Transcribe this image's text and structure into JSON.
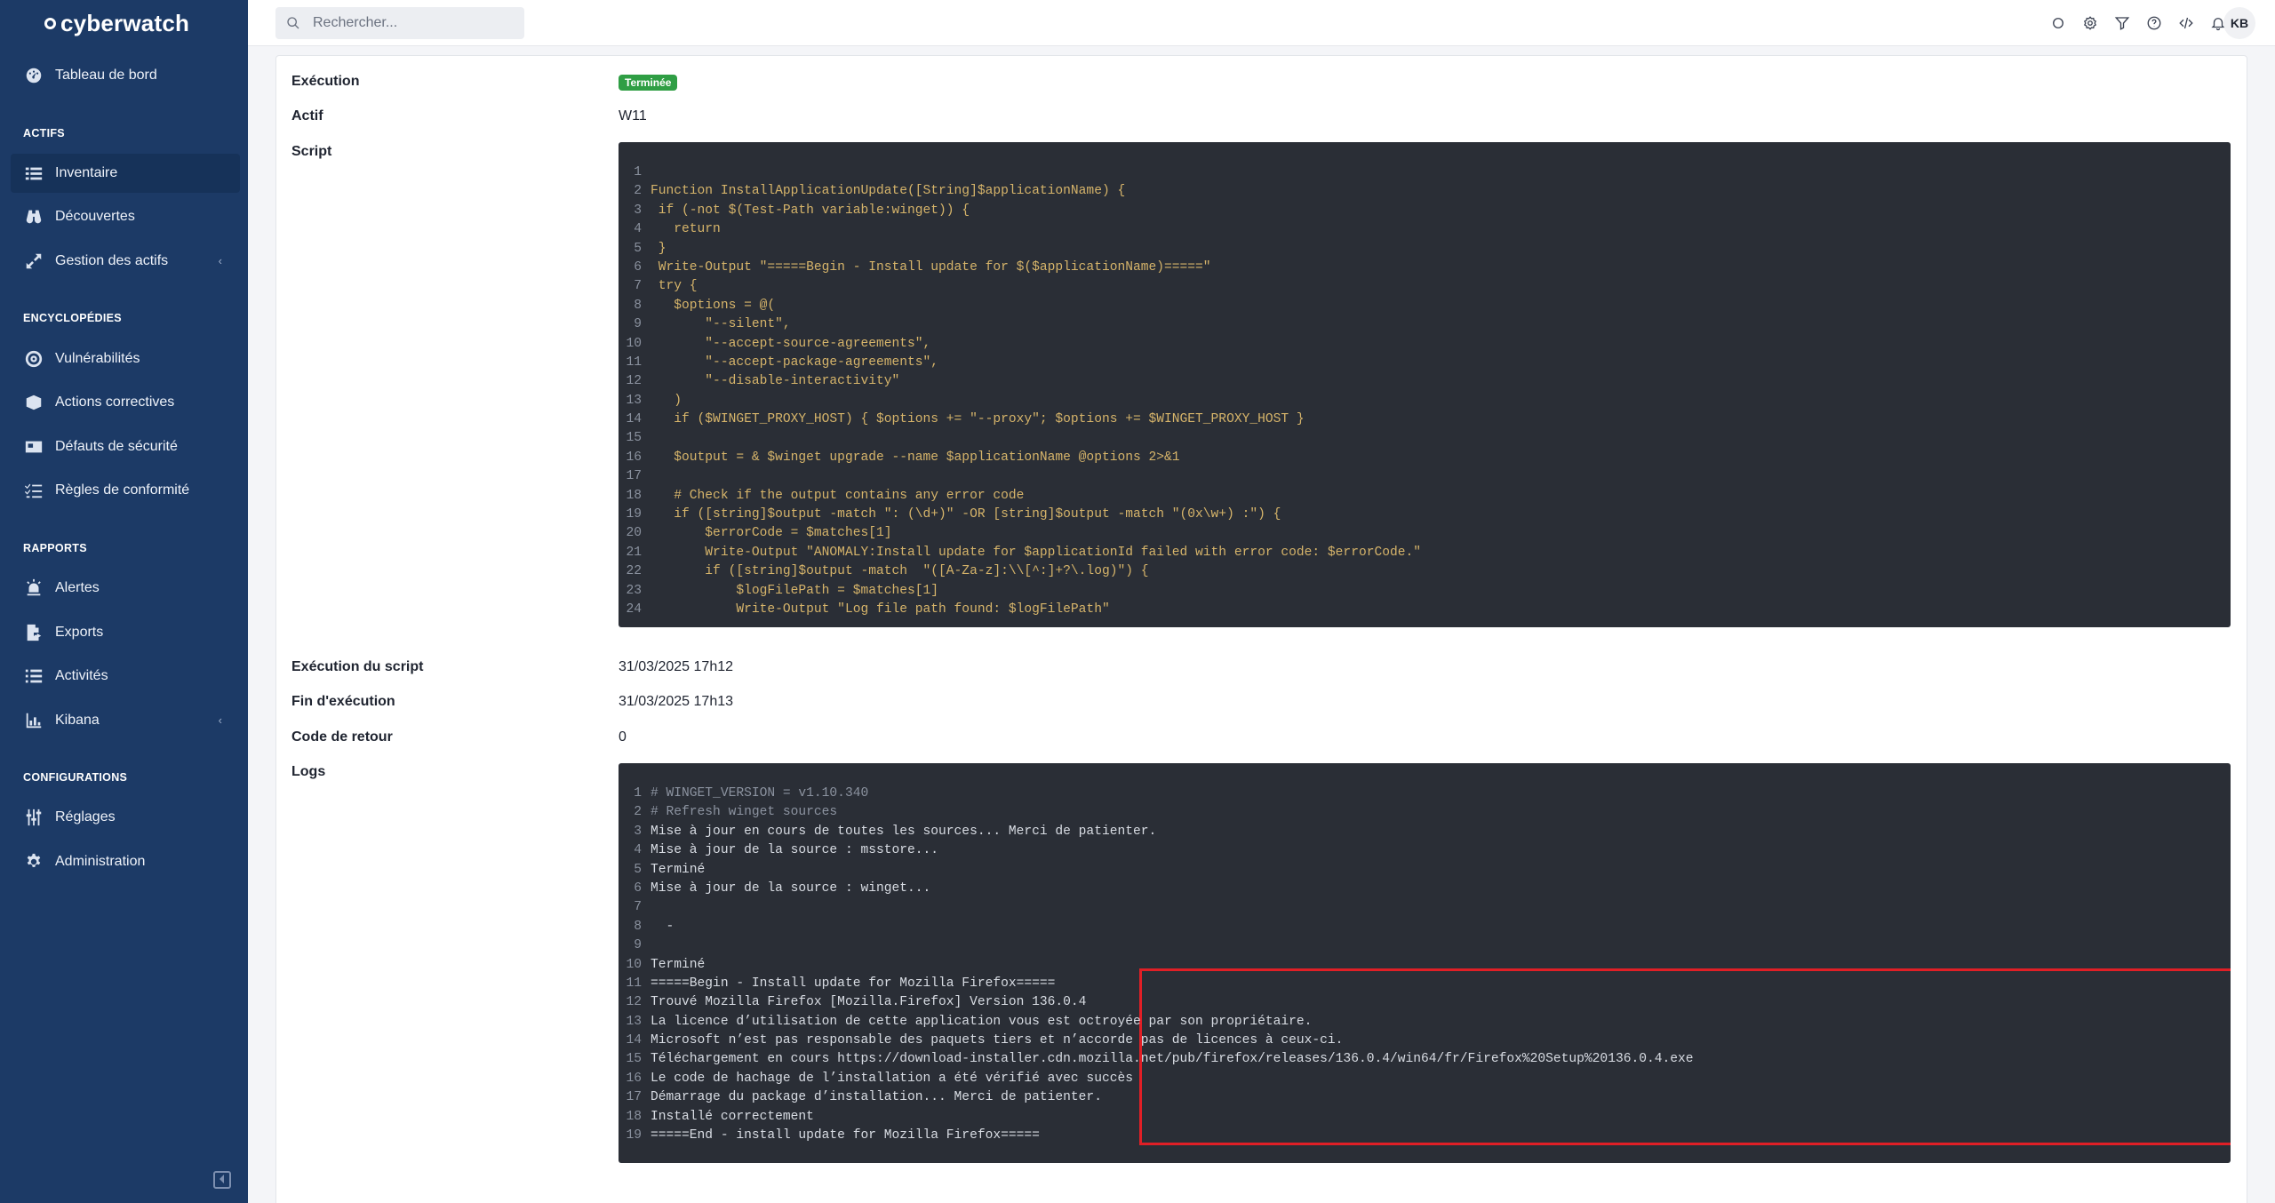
{
  "brand": {
    "name": "cyberwatch"
  },
  "sidebar": {
    "top_items": [
      {
        "label": "Tableau de bord",
        "icon": "dashboard-icon"
      }
    ],
    "sections": [
      {
        "title": "ACTIFS",
        "items": [
          {
            "label": "Inventaire",
            "icon": "list-icon",
            "active": true
          },
          {
            "label": "Découvertes",
            "icon": "binoculars-icon"
          },
          {
            "label": "Gestion des actifs",
            "icon": "expand-icon",
            "has_chevron": true
          }
        ]
      },
      {
        "title": "ENCYCLOPÉDIES",
        "items": [
          {
            "label": "Vulnérabilités",
            "icon": "target-icon"
          },
          {
            "label": "Actions correctives",
            "icon": "box-icon"
          },
          {
            "label": "Défauts de sécurité",
            "icon": "id-card-icon"
          },
          {
            "label": "Règles de conformité",
            "icon": "checklist-icon"
          }
        ]
      },
      {
        "title": "RAPPORTS",
        "items": [
          {
            "label": "Alertes",
            "icon": "alarm-icon"
          },
          {
            "label": "Exports",
            "icon": "file-export-icon"
          },
          {
            "label": "Activités",
            "icon": "activity-list-icon"
          },
          {
            "label": "Kibana",
            "icon": "bar-chart-icon",
            "has_chevron": true
          }
        ]
      },
      {
        "title": "CONFIGURATIONS",
        "items": [
          {
            "label": "Réglages",
            "icon": "sliders-icon"
          },
          {
            "label": "Administration",
            "icon": "gear-icon"
          }
        ]
      }
    ]
  },
  "topbar": {
    "search_placeholder": "Rechercher...",
    "icons": [
      "circle-icon",
      "settings-icon",
      "filter-icon",
      "help-icon",
      "code-icon",
      "bell-icon"
    ],
    "avatar_initials": "KB"
  },
  "details": {
    "execution_label": "Exécution",
    "execution_status": "Terminée",
    "status_color": "#2f9e44",
    "asset_label": "Actif",
    "asset_value": "W11",
    "script_label": "Script",
    "script_exec_label": "Exécution du script",
    "script_exec_value": "31/03/2025 17h12",
    "end_label": "Fin d'exécution",
    "end_value": "31/03/2025 17h13",
    "return_code_label": "Code de retour",
    "return_code_value": "0",
    "logs_label": "Logs"
  },
  "script_lines": [
    "",
    "Function InstallApplicationUpdate([String]$applicationName) {",
    " if (-not $(Test-Path variable:winget)) {",
    "   return",
    " }",
    " Write-Output \"=====Begin - Install update for $($applicationName)=====\"",
    " try {",
    "   $options = @(",
    "       \"--silent\",",
    "       \"--accept-source-agreements\",",
    "       \"--accept-package-agreements\",",
    "       \"--disable-interactivity\"",
    "   )",
    "   if ($WINGET_PROXY_HOST) { $options += \"--proxy\"; $options += $WINGET_PROXY_HOST }",
    "",
    "   $output = & $winget upgrade --name $applicationName @options 2>&1",
    "",
    "   # Check if the output contains any error code",
    "   if ([string]$output -match \": (\\d+)\" -OR [string]$output -match \"(0x\\w+) :\") {",
    "       $errorCode = $matches[1]",
    "       Write-Output \"ANOMALY:Install update for $applicationId failed with error code: $errorCode.\"",
    "       if ([string]$output -match  \"([A-Za-z]:\\\\[^:]+?\\.log)\") {",
    "           $logFilePath = $matches[1]",
    "           Write-Output \"Log file path found: $logFilePath\""
  ],
  "log_lines": [
    "# WINGET_VERSION = v1.10.340",
    "# Refresh winget sources",
    "Mise à jour en cours de toutes les sources... Merci de patienter.",
    "Mise à jour de la source : msstore...",
    "Terminé",
    "Mise à jour de la source : winget...",
    "",
    "  -",
    "",
    "Terminé",
    "=====Begin - Install update for Mozilla Firefox=====",
    "Trouvé Mozilla Firefox [Mozilla.Firefox] Version 136.0.4",
    "La licence d’utilisation de cette application vous est octroyée par son propriétaire.",
    "Microsoft n’est pas responsable des paquets tiers et n’accorde pas de licences à ceux-ci.",
    "Téléchargement en cours https://download-installer.cdn.mozilla.net/pub/firefox/releases/136.0.4/win64/fr/Firefox%20Setup%20136.0.4.exe",
    "Le code de hachage de l’installation a été vérifié avec succès",
    "Démarrage du package d’installation... Merci de patienter.",
    "Installé correctement",
    "=====End - install update for Mozilla Firefox====="
  ],
  "colors": {
    "sidebar_bg": "#1c3a66",
    "highlight_border": "#e01f26",
    "code_bg": "#2a2e36"
  }
}
